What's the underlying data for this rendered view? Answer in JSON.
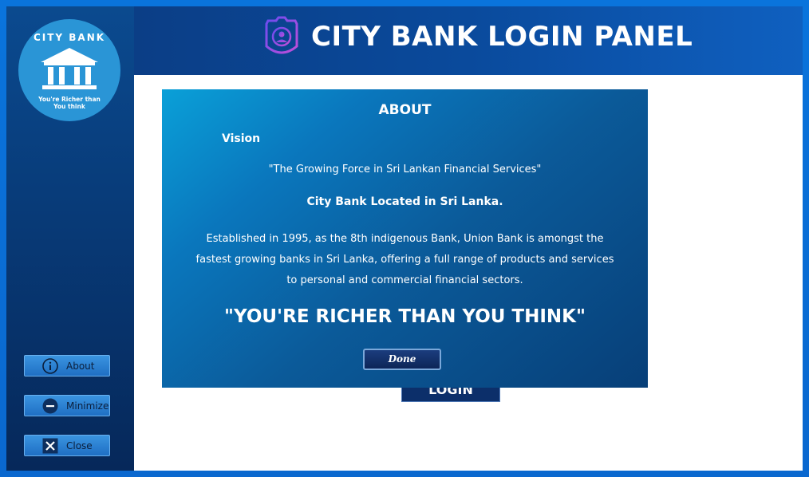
{
  "app": {
    "logo_top": "CITY BANK",
    "logo_tagline_1": "You're Richer than",
    "logo_tagline_2": "You think",
    "header_title": "CITY BANK LOGIN PANEL"
  },
  "sidebar": {
    "buttons": [
      {
        "label": "About",
        "icon": "info-icon"
      },
      {
        "label": "Minimize",
        "icon": "minus-icon"
      },
      {
        "label": "Close",
        "icon": "close-icon"
      }
    ]
  },
  "main": {
    "login_label": "LOGIN"
  },
  "about_dialog": {
    "title": "ABOUT",
    "vision_label": "Vision",
    "vision_quote": "\"The Growing Force in Sri Lankan Financial Services\"",
    "location": "City Bank Located in Sri Lanka.",
    "description": "Established in 1995, as the 8th indigenous Bank, Union Bank is amongst the fastest growing banks in Sri Lanka, offering a full range of products and services to personal and commercial financial sectors.",
    "slogan": "\"YOU'RE RICHER THAN YOU THINK\"",
    "done_label": "Done"
  },
  "colors": {
    "frame": "#0a6fd6",
    "sidebar": "#083c7a",
    "header": "#0a4a9c",
    "dialog": "#0b5a99",
    "content": "#ffffff"
  }
}
